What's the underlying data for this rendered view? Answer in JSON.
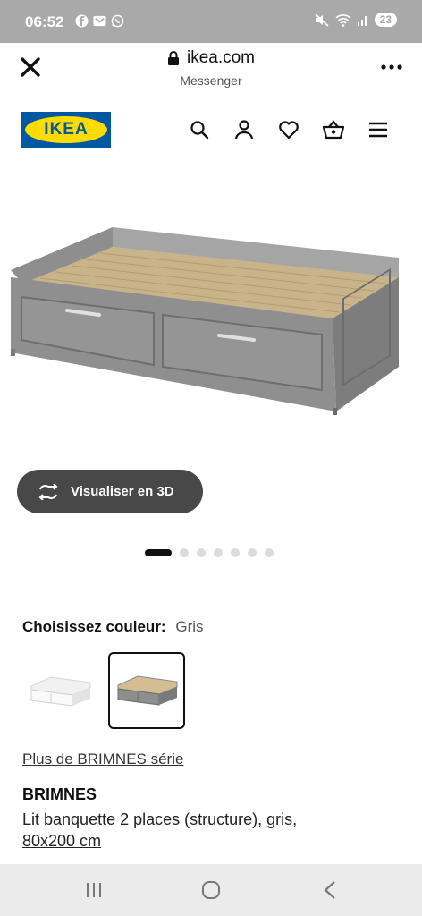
{
  "status_bar": {
    "time": "06:52",
    "battery": "23",
    "left_icons": [
      "facebook-icon",
      "gmail-icon",
      "whatsapp-icon"
    ],
    "right_icons": [
      "mute-icon",
      "wifi-icon",
      "signal-icon"
    ]
  },
  "browser": {
    "url": "ikea.com",
    "subtitle": "Messenger",
    "close_icon": "close-icon",
    "menu_icon": "more-vertical-dots-icon"
  },
  "ikea_header": {
    "logo_text": "IKEA",
    "icons": [
      "search-icon",
      "user-icon",
      "heart-icon",
      "basket-icon",
      "hamburger-menu-icon"
    ],
    "brand_blue": "#0058a3",
    "brand_yellow": "#ffdb00"
  },
  "product_view": {
    "viz_label": "Visualiser en 3D",
    "image_count": 7,
    "active_image_index": 0
  },
  "color_selector": {
    "label": "Choisissez couleur:",
    "value": "Gris",
    "options": [
      "white",
      "grey"
    ],
    "selected": "grey"
  },
  "product": {
    "series_link": "Plus de BRIMNES série",
    "name": "BRIMNES",
    "description": "Lit banquette 2 places (structure), gris,",
    "size": "80x200 cm"
  },
  "nav_bar": {
    "icons": [
      "recent-apps-icon",
      "home-icon",
      "back-icon"
    ]
  }
}
